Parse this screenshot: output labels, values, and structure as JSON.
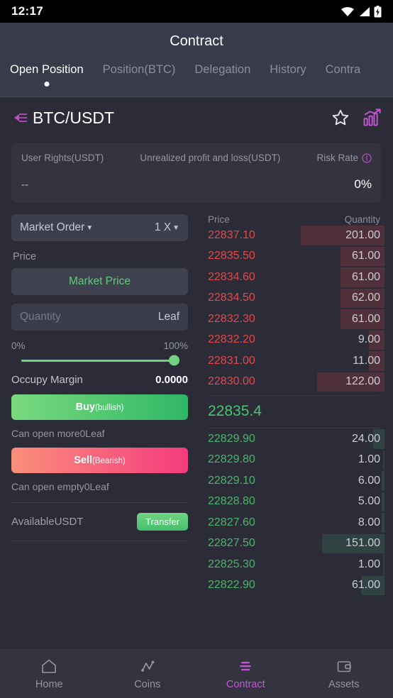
{
  "status_bar": {
    "time": "12:17",
    "icons": [
      "wifi-icon",
      "signal-icon",
      "battery-charging-icon"
    ]
  },
  "header": {
    "title": "Contract"
  },
  "tabs": [
    {
      "label": "Open Position",
      "active": true
    },
    {
      "label": "Position(BTC)",
      "active": false
    },
    {
      "label": "Delegation",
      "active": false
    },
    {
      "label": "History",
      "active": false
    },
    {
      "label": "Contra",
      "active": false
    }
  ],
  "pair_header": {
    "back_icon": "collapse-left-icon",
    "pair": "BTC/USDT",
    "favorite_icon": "star-icon",
    "chart_icon": "bar-chart-icon"
  },
  "account_card": {
    "user_rights_label": "User Rights(USDT)",
    "user_rights_value": "--",
    "unrealized_label": "Unrealized profit and loss(USDT)",
    "unrealized_value": "",
    "risk_rate_label": "Risk Rate",
    "risk_info_icon": "info-icon",
    "risk_rate_value": "0%"
  },
  "order_form": {
    "order_type": "Market Order",
    "leverage": "1 X",
    "price_label": "Price",
    "price_value": "Market Price",
    "quantity_placeholder": "Quantity",
    "quantity_unit": "Leaf",
    "pct_min": "0%",
    "pct_max": "100%",
    "slider_value": 100,
    "occupy_margin_label": "Occupy Margin",
    "occupy_margin_value": "0.0000",
    "buy_label": "Buy",
    "buy_sub": "(bullish)",
    "can_open_more": "Can open more0Leaf",
    "sell_label": "Sell",
    "sell_sub": "(Bearish)",
    "can_open_empty": "Can open empty0Leaf",
    "available_label": "AvailableUSDT",
    "transfer_label": "Transfer"
  },
  "order_book": {
    "price_header": "Price",
    "quantity_header": "Quantity",
    "mid_price": "22835.4",
    "asks": [
      {
        "price": "22837.10",
        "qty": "201.00",
        "depth": 118
      },
      {
        "price": "22835.50",
        "qty": "61.00",
        "depth": 62
      },
      {
        "price": "22834.60",
        "qty": "61.00",
        "depth": 62
      },
      {
        "price": "22834.50",
        "qty": "62.00",
        "depth": 62
      },
      {
        "price": "22832.30",
        "qty": "61.00",
        "depth": 62
      },
      {
        "price": "22832.20",
        "qty": "9.00",
        "depth": 22
      },
      {
        "price": "22831.00",
        "qty": "11.00",
        "depth": 22
      },
      {
        "price": "22830.00",
        "qty": "122.00",
        "depth": 95
      }
    ],
    "bids": [
      {
        "price": "22829.90",
        "qty": "24.00",
        "depth": 16
      },
      {
        "price": "22829.80",
        "qty": "1.00",
        "depth": 2
      },
      {
        "price": "22829.10",
        "qty": "6.00",
        "depth": 4
      },
      {
        "price": "22828.80",
        "qty": "5.00",
        "depth": 4
      },
      {
        "price": "22827.60",
        "qty": "8.00",
        "depth": 4
      },
      {
        "price": "22827.50",
        "qty": "151.00",
        "depth": 88
      },
      {
        "price": "22825.30",
        "qty": "1.00",
        "depth": 2
      },
      {
        "price": "22822.90",
        "qty": "61.00",
        "depth": 33
      }
    ]
  },
  "bottom_nav": [
    {
      "label": "Home",
      "icon": "home-icon",
      "active": false
    },
    {
      "label": "Coins",
      "icon": "chart-line-icon",
      "active": false
    },
    {
      "label": "Contract",
      "icon": "contract-icon",
      "active": true
    },
    {
      "label": "Assets",
      "icon": "wallet-icon",
      "active": false
    }
  ],
  "colors": {
    "accent": "#c855d6",
    "buy_green": "#4cc172",
    "sell_red": "#e04a4a",
    "page_bg": "#2b2c38",
    "panel_bg": "#33343f"
  }
}
